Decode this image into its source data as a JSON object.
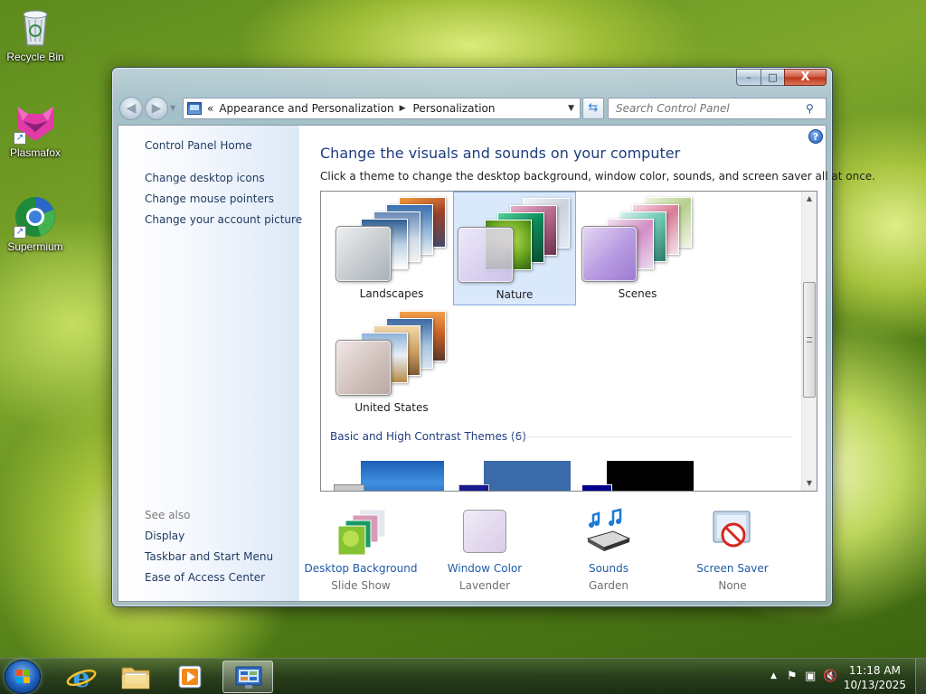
{
  "desktop": {
    "icons": [
      {
        "name": "recycle-bin",
        "label": "Recycle Bin"
      },
      {
        "name": "plasmafox",
        "label": "Plasmafox"
      },
      {
        "name": "supermium",
        "label": "Supermium"
      }
    ]
  },
  "window": {
    "breadcrumb": [
      "Appearance and Personalization",
      "Personalization"
    ],
    "breadcrumb_prefix": "«",
    "search_placeholder": "Search Control Panel",
    "caption": {
      "minimize": "–",
      "maximize": "□",
      "close": "X"
    }
  },
  "left_nav": {
    "home": "Control Panel Home",
    "links": [
      "Change desktop icons",
      "Change mouse pointers",
      "Change your account picture"
    ],
    "see_also_label": "See also",
    "see_also": [
      "Display",
      "Taskbar and Start Menu",
      "Ease of Access Center"
    ]
  },
  "main": {
    "title": "Change the visuals and sounds on your computer",
    "subtitle": "Click a theme to change the desktop background, window color, sounds, and screen saver all at once.",
    "themes": [
      {
        "name": "Landscapes",
        "selected": false
      },
      {
        "name": "Nature",
        "selected": true
      },
      {
        "name": "Scenes",
        "selected": false
      },
      {
        "name": "United States",
        "selected": false
      }
    ],
    "basic_section": "Basic and High Contrast Themes (6)",
    "help": "?"
  },
  "settings": [
    {
      "label": "Desktop Background",
      "value": "Slide Show"
    },
    {
      "label": "Window Color",
      "value": "Lavender"
    },
    {
      "label": "Sounds",
      "value": "Garden"
    },
    {
      "label": "Screen Saver",
      "value": "None"
    }
  ],
  "taskbar": {
    "time": "11:18 AM",
    "date": "10/13/2025",
    "apps": [
      "internet-explorer",
      "file-explorer",
      "media-player",
      "control-panel"
    ]
  },
  "colors": {
    "link": "#1e5aa8",
    "title": "#1e3c7d",
    "selection": "#d9e8fb"
  }
}
